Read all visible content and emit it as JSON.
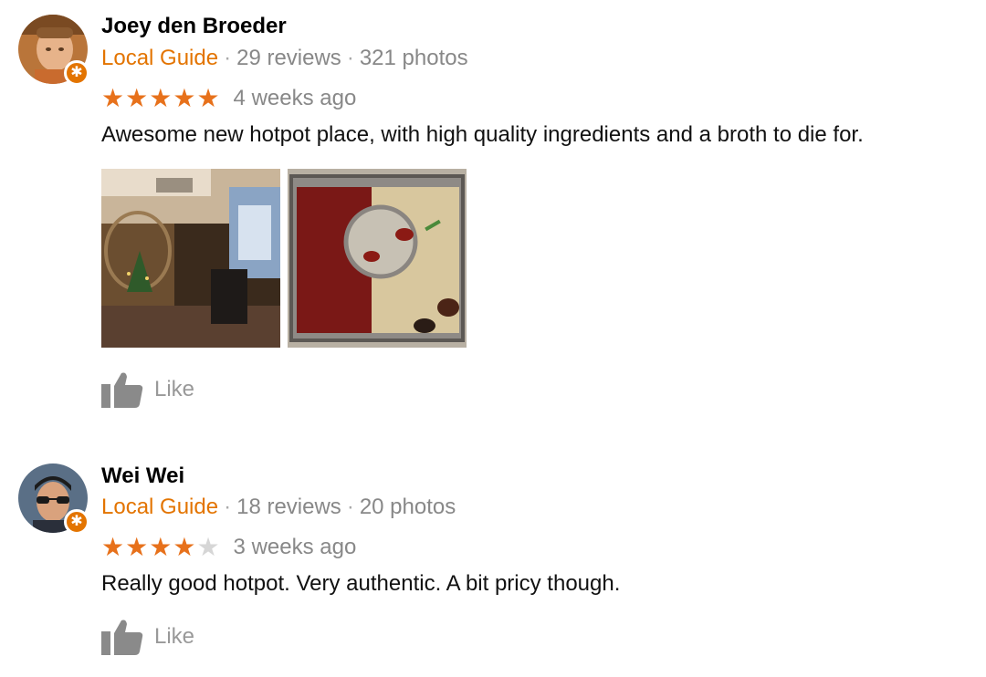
{
  "reviews": [
    {
      "name": "Joey den Broeder",
      "badge": "Local Guide",
      "reviews_count": "29 reviews",
      "photos_count": "321 photos",
      "rating": 5,
      "max_rating": 5,
      "time_ago": "4 weeks ago",
      "text": "Awesome new hotpot place, with high quality ingredients and a broth to die for.",
      "like_label": "Like"
    },
    {
      "name": "Wei Wei",
      "badge": "Local Guide",
      "reviews_count": "18 reviews",
      "photos_count": "20 photos",
      "rating": 4,
      "max_rating": 5,
      "time_ago": "3 weeks ago",
      "text": "Really good hotpot. Very authentic. A bit pricy though.",
      "like_label": "Like"
    }
  ],
  "colors": {
    "local_guide": "#e37400",
    "star_on": "#e7711b",
    "star_off": "#d6d6d6",
    "muted_text": "#888888"
  },
  "icons": {
    "badge": "star-badge-icon",
    "like": "thumbs-up-icon"
  }
}
